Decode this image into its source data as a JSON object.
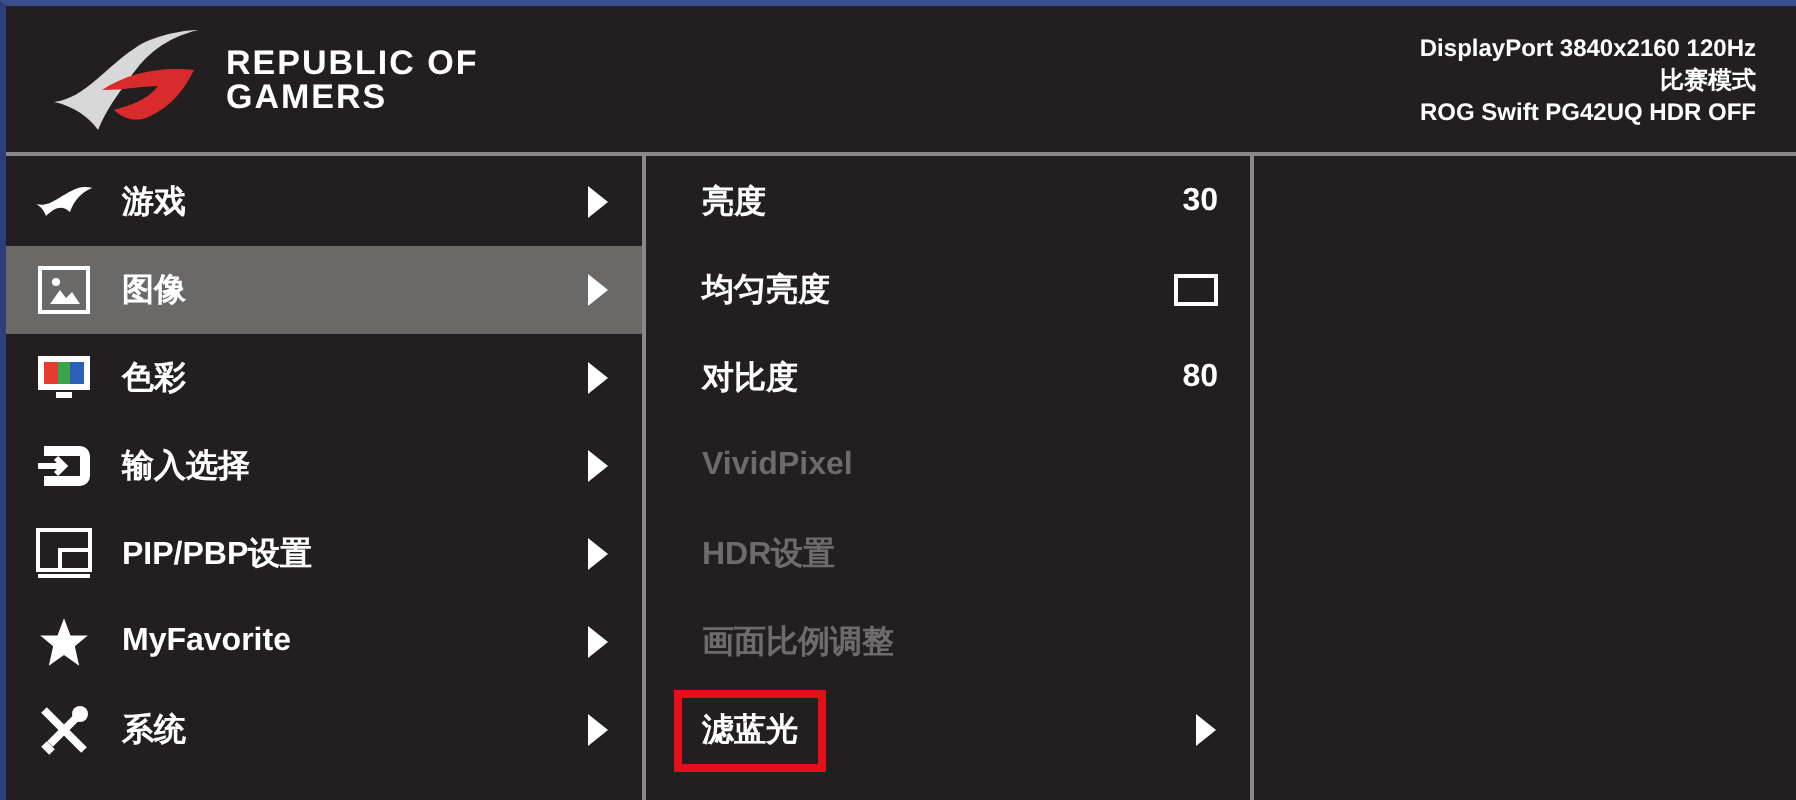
{
  "header": {
    "brand": [
      "REPUBLIC OF",
      "GAMERS"
    ],
    "status": [
      "DisplayPort 3840x2160 120Hz",
      "比赛模式",
      "ROG Swift PG42UQ HDR OFF"
    ]
  },
  "main_menu": [
    {
      "label": "游戏",
      "selected": false
    },
    {
      "label": "图像",
      "selected": true
    },
    {
      "label": "色彩",
      "selected": false
    },
    {
      "label": "输入选择",
      "selected": false
    },
    {
      "label": "PIP/PBP设置",
      "selected": false
    },
    {
      "label": "MyFavorite",
      "selected": false
    },
    {
      "label": "系统",
      "selected": false
    }
  ],
  "sub_menu": [
    {
      "kind": "value",
      "label": "亮度",
      "value": "30",
      "disabled": false,
      "highlighted": false
    },
    {
      "kind": "checkbox",
      "label": "均匀亮度",
      "checked": false,
      "disabled": false,
      "highlighted": false
    },
    {
      "kind": "value",
      "label": "对比度",
      "value": "80",
      "disabled": false,
      "highlighted": false
    },
    {
      "kind": "plain",
      "label": "VividPixel",
      "disabled": true,
      "highlighted": false
    },
    {
      "kind": "plain",
      "label": "HDR设置",
      "disabled": true,
      "highlighted": false
    },
    {
      "kind": "plain",
      "label": "画面比例调整",
      "disabled": true,
      "highlighted": false
    },
    {
      "kind": "submenu",
      "label": "滤蓝光",
      "disabled": false,
      "highlighted": true
    }
  ]
}
